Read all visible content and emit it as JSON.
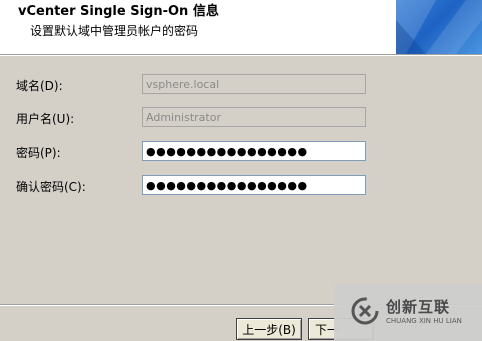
{
  "header": {
    "title": "vCenter Single Sign-On 信息",
    "subtitle": "设置默认域中管理员帐户的密码"
  },
  "form": {
    "domain_label": "域名(D):",
    "domain_value": "vsphere.local",
    "username_label": "用户名(U):",
    "username_value": "Administrator",
    "password_label": "密码(P):",
    "password_value": "●●●●●●●●●●●●●●●●",
    "confirm_label": "确认密码(C):",
    "confirm_value": "●●●●●●●●●●●●●●●●"
  },
  "buttons": {
    "back": "上一步(B)",
    "next": "下一"
  },
  "watermark": {
    "text": "创新互联",
    "subtext": "CHUANG XIN HU LIAN"
  },
  "colors": {
    "background": "#d4d0c8",
    "header_graphic": "#1e63c4"
  }
}
